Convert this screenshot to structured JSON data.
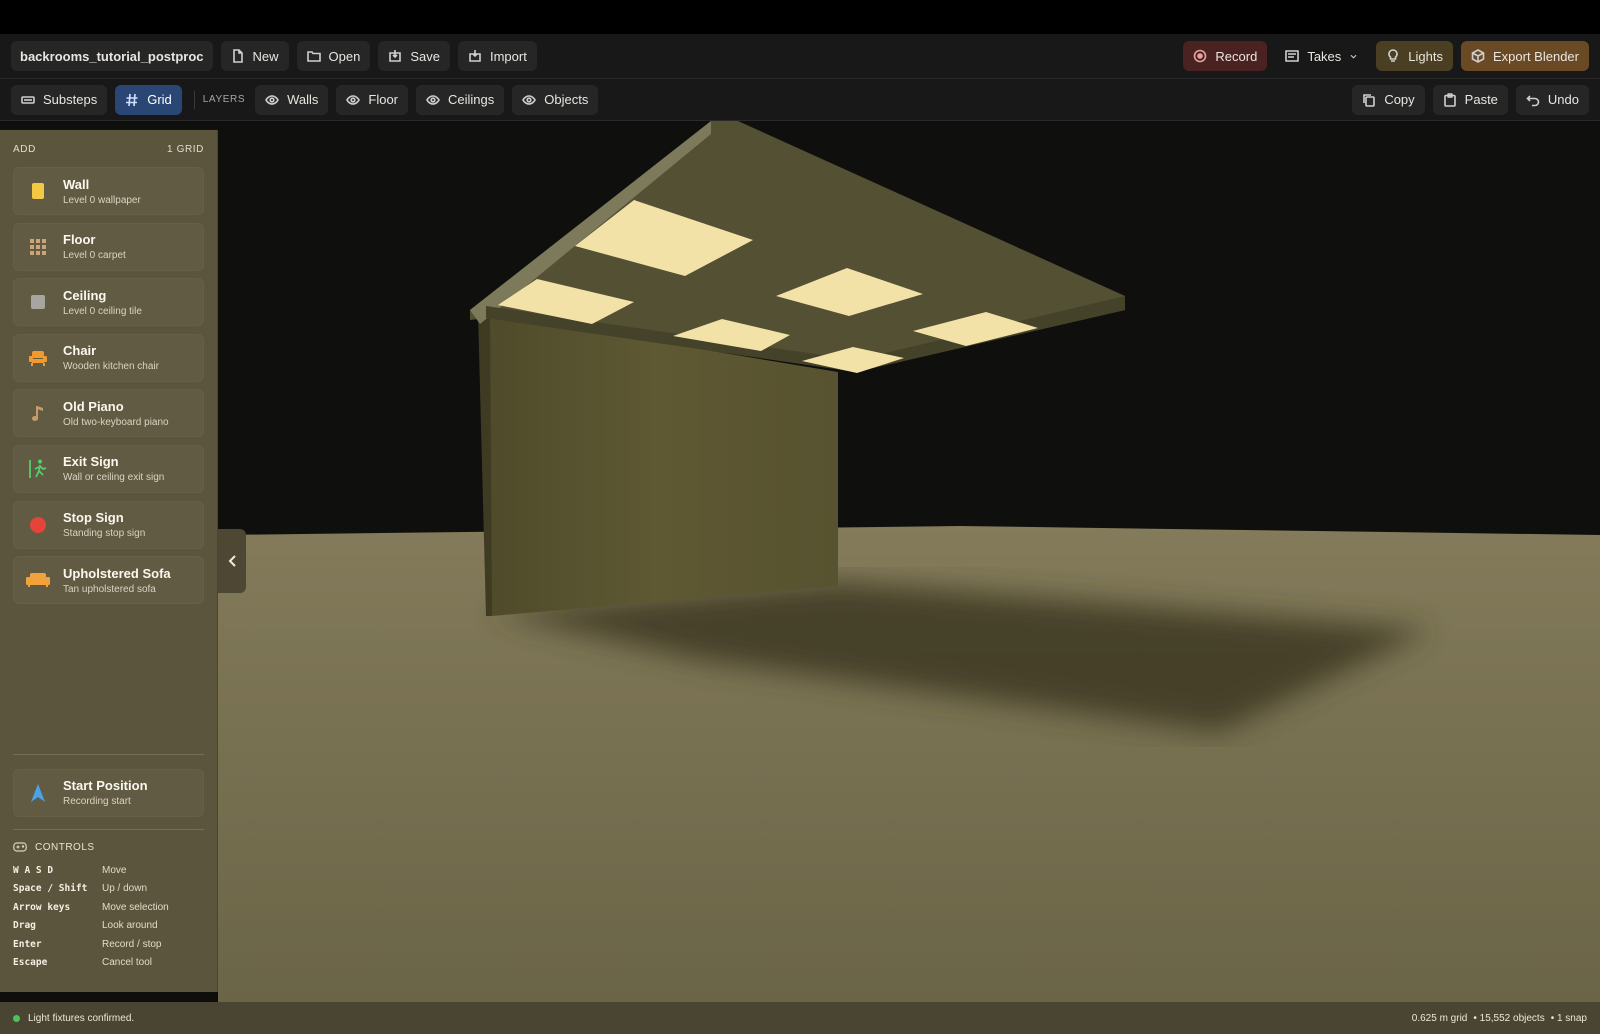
{
  "header": {
    "project_name": "backrooms_tutorial_postproc",
    "new_label": "New",
    "open_label": "Open",
    "save_label": "Save",
    "import_label": "Import",
    "record_label": "Record",
    "takes_label": "Takes",
    "lights_label": "Lights",
    "export_label": "Export Blender"
  },
  "toolbar": {
    "substeps_label": "Substeps",
    "grid_label": "Grid",
    "layers_label": "LAYERS",
    "walls_label": "Walls",
    "floor_label": "Floor",
    "ceilings_label": "Ceilings",
    "objects_label": "Objects",
    "copy_label": "Copy",
    "paste_label": "Paste",
    "undo_label": "Undo"
  },
  "sidebar": {
    "add_label": "ADD",
    "grid_count": "1 GRID",
    "items": [
      {
        "name": "Wall",
        "desc": "Level 0 wallpaper",
        "icon": "wall-icon"
      },
      {
        "name": "Floor",
        "desc": "Level 0 carpet",
        "icon": "floor-grid-icon"
      },
      {
        "name": "Ceiling",
        "desc": "Level 0 ceiling tile",
        "icon": "ceiling-icon"
      },
      {
        "name": "Chair",
        "desc": "Wooden kitchen chair",
        "icon": "chair-icon"
      },
      {
        "name": "Old Piano",
        "desc": "Old two-keyboard piano",
        "icon": "music-note-icon"
      },
      {
        "name": "Exit Sign",
        "desc": "Wall or ceiling exit sign",
        "icon": "exit-person-icon"
      },
      {
        "name": "Stop Sign",
        "desc": "Standing stop sign",
        "icon": "stop-circle-icon"
      },
      {
        "name": "Upholstered Sofa",
        "desc": "Tan upholstered sofa",
        "icon": "sofa-icon"
      }
    ],
    "start": {
      "name": "Start Position",
      "desc": "Recording start",
      "icon": "navigation-arrow-icon"
    },
    "controls_label": "CONTROLS",
    "controls": [
      {
        "key": "W A S D",
        "action": "Move"
      },
      {
        "key": "Space / Shift",
        "action": "Up / down"
      },
      {
        "key": "Arrow keys",
        "action": "Move selection"
      },
      {
        "key": "Drag",
        "action": "Look around"
      },
      {
        "key": "Enter",
        "action": "Record / stop"
      },
      {
        "key": "Escape",
        "action": "Cancel tool"
      }
    ]
  },
  "status": {
    "message": "Light fixtures confirmed.",
    "grid_size": "0.625 m grid",
    "objects": "• 15,552 objects",
    "snap": "• 1 snap"
  },
  "colors": {
    "accent_grid": "#2a4675",
    "record": "#4a2222",
    "lights": "#4a3f22",
    "export": "#6a4a25",
    "sidebar": "#5c553e",
    "status_ok": "#4cc35a"
  }
}
